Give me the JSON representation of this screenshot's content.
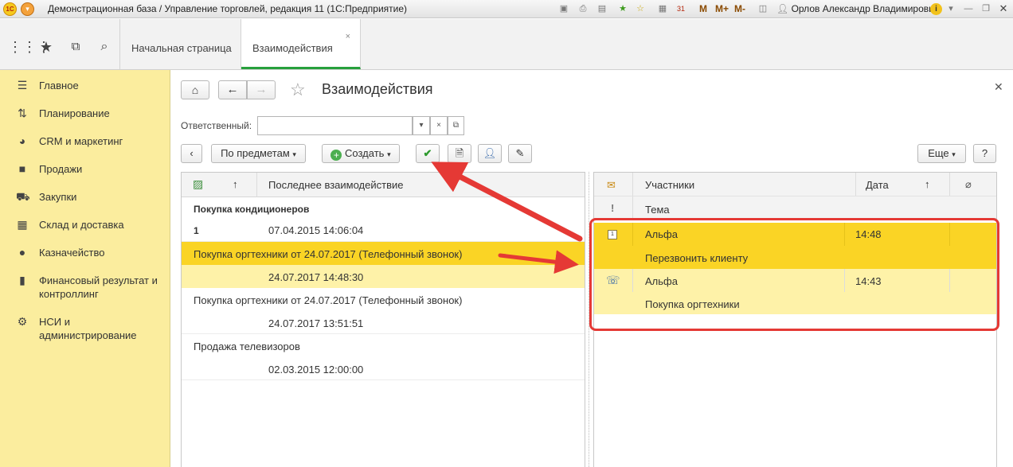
{
  "window": {
    "title": "Демонстрационная база / Управление торговлей, редакция 11 (1С:Предприятие)",
    "user": "Орлов Александр Владимирович",
    "memory_buttons": [
      "M",
      "M+",
      "M-"
    ]
  },
  "tabs": [
    {
      "label": "Начальная страница"
    },
    {
      "label": "Взаимодействия"
    }
  ],
  "sidebar": {
    "items": [
      {
        "label": "Главное",
        "icon": "menu-lines-icon"
      },
      {
        "label": "Планирование",
        "icon": "planning-icon"
      },
      {
        "label": "CRM и маркетинг",
        "icon": "pie-chart-icon"
      },
      {
        "label": "Продажи",
        "icon": "bag-icon"
      },
      {
        "label": "Закупки",
        "icon": "cart-icon"
      },
      {
        "label": "Склад и доставка",
        "icon": "warehouse-icon"
      },
      {
        "label": "Казначейство",
        "icon": "coin-icon"
      },
      {
        "label": "Финансовый результат и контроллинг",
        "icon": "bar-chart-icon"
      },
      {
        "label": "НСИ и администрирование",
        "icon": "gear-icon"
      }
    ]
  },
  "page": {
    "title": "Взаимодействия",
    "responsible_label": "Ответственный:",
    "responsible_value": "",
    "group_by_button": "По предметам",
    "create_button": "Создать",
    "more_button": "Еще",
    "help_button": "?"
  },
  "left_grid": {
    "columns": [
      "↑",
      "Последнее взаимодействие"
    ],
    "rows": [
      {
        "subject": "Покупка кондиционеров",
        "count": "1",
        "date": "07.04.2015 14:06:04",
        "state": "group"
      },
      {
        "subject": "Покупка оргтехники от 24.07.2017 (Телефонный звонок)",
        "date": "24.07.2017 14:48:30",
        "state": "selected"
      },
      {
        "subject": "Покупка оргтехники от 24.07.2017 (Телефонный звонок)",
        "date": "24.07.2017 13:51:51",
        "state": "normal"
      },
      {
        "subject": "Продажа телевизоров",
        "date": "02.03.2015 12:00:00",
        "state": "normal"
      }
    ]
  },
  "right_grid": {
    "columns": {
      "participants": "Участники",
      "date": "Дата",
      "sort": "↑",
      "topic": "Тема",
      "important": "!"
    },
    "rows": [
      {
        "participant": "Альфа",
        "time": "14:48",
        "topic": "Перезвонить клиенту",
        "type_icon": "calendar-icon",
        "state": "selected"
      },
      {
        "participant": "Альфа",
        "time": "14:43",
        "topic": "Покупка оргтехники",
        "type_icon": "phone-icon",
        "state": "highlighted"
      }
    ]
  },
  "colors": {
    "sidebar_bg": "#fbed9e",
    "selected_row": "#fad425",
    "highlight_row": "#fef2a8",
    "annotation_red": "#e53935",
    "active_tab_accent": "#27a03c"
  }
}
